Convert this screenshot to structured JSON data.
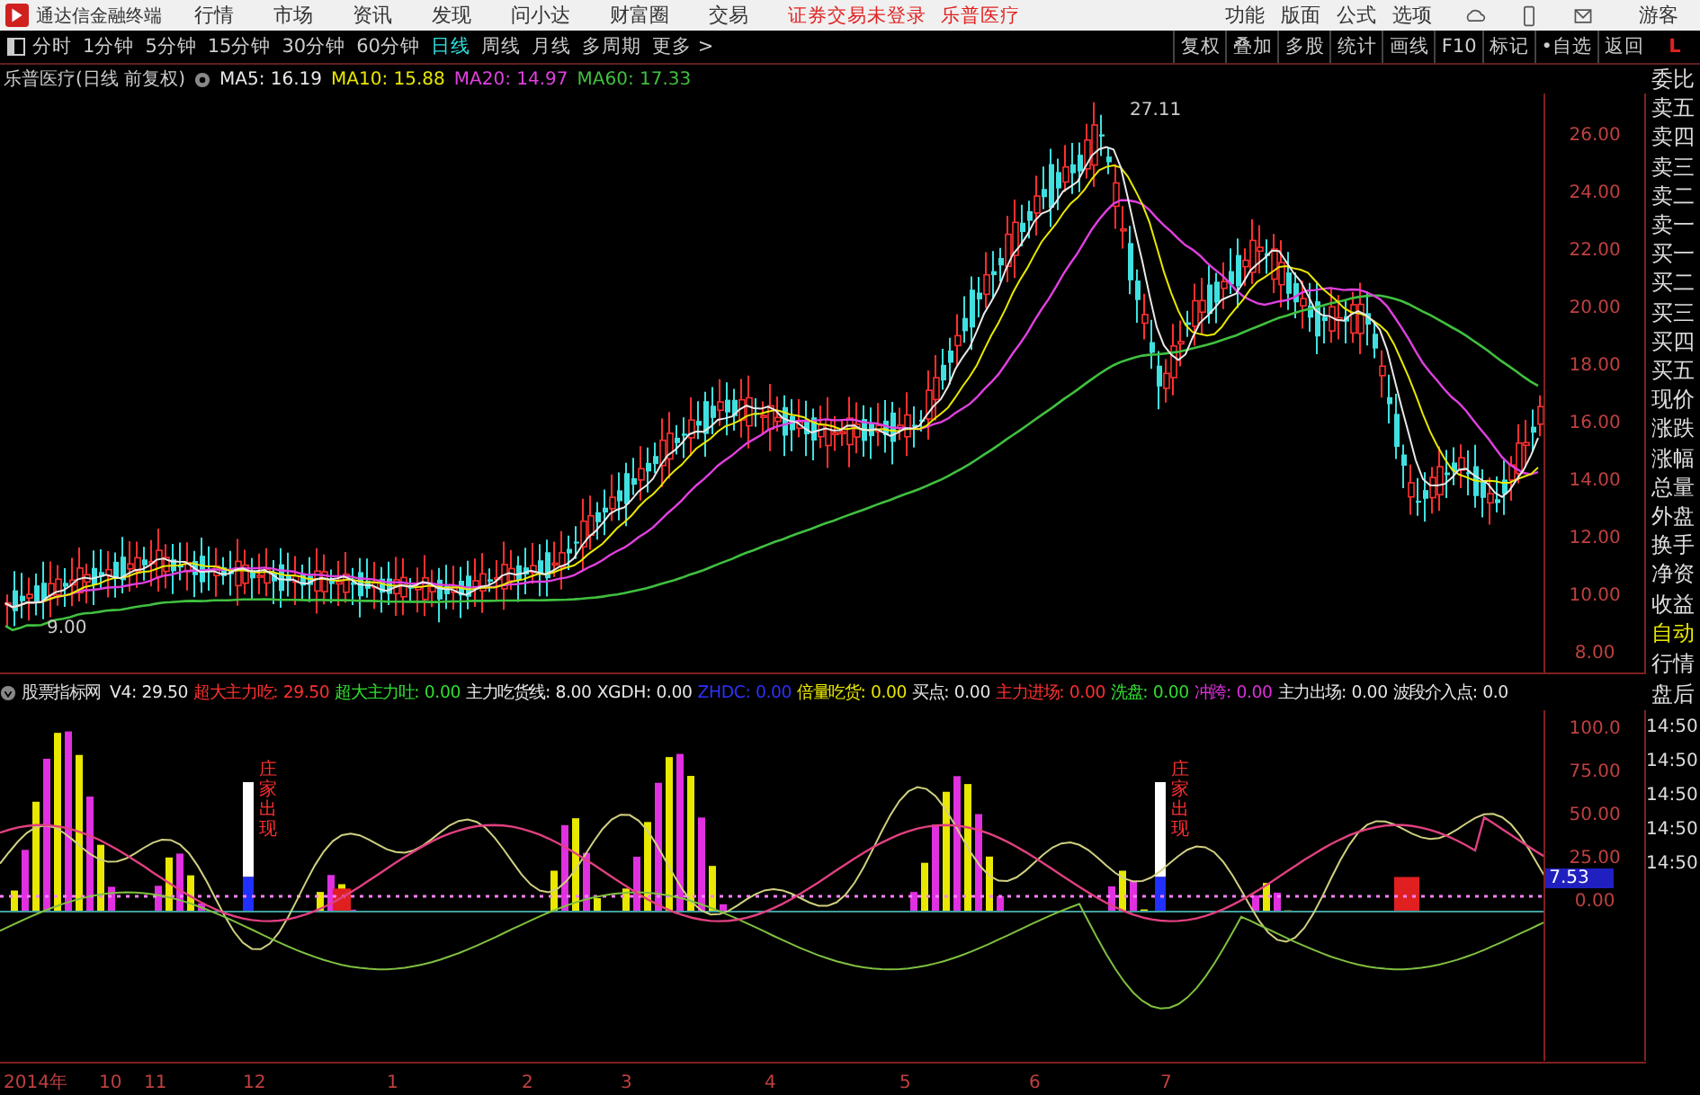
{
  "menu_bar": {
    "app_title": "通达信金融终端",
    "items": [
      "行情",
      "市场",
      "资讯",
      "发现",
      "问小达",
      "财富圈",
      "交易"
    ],
    "status": "证券交易未登录",
    "stock": "乐普医疗",
    "right_items": [
      "功能",
      "版面",
      "公式",
      "选项"
    ],
    "user": "游客"
  },
  "toolbar": {
    "periods": [
      {
        "label": "分时",
        "selected": false
      },
      {
        "label": "1分钟",
        "selected": false
      },
      {
        "label": "5分钟",
        "selected": false
      },
      {
        "label": "15分钟",
        "selected": false
      },
      {
        "label": "30分钟",
        "selected": false
      },
      {
        "label": "60分钟",
        "selected": false
      },
      {
        "label": "日线",
        "selected": true
      },
      {
        "label": "周线",
        "selected": false
      },
      {
        "label": "月线",
        "selected": false
      },
      {
        "label": "多周期",
        "selected": false
      },
      {
        "label": "更多 >",
        "selected": false
      }
    ],
    "buttons": [
      "复权",
      "叠加",
      "多股",
      "统计",
      "画线",
      "F10",
      "标记",
      "•自选",
      "返回"
    ],
    "corner": "L"
  },
  "chart": {
    "title": "乐普医疗(日线 前复权)",
    "ma": [
      {
        "label": "MA5: 16.19",
        "color": "#e8e8e8"
      },
      {
        "label": "MA10: 15.88",
        "color": "#e8e800"
      },
      {
        "label": "MA20: 14.97",
        "color": "#e040e0"
      },
      {
        "label": "MA60: 17.33",
        "color": "#40c040"
      }
    ],
    "price_ticks": [
      "26.00",
      "24.00",
      "22.00",
      "20.00",
      "18.00",
      "16.00",
      "14.00",
      "12.00",
      "10.00",
      "8.00"
    ],
    "high_label": "27.11",
    "low_label": "9.00"
  },
  "side_panel": {
    "quote_items": [
      "委比",
      "卖五",
      "卖四",
      "卖三",
      "卖二",
      "卖一",
      "买一",
      "买二",
      "买三",
      "买四",
      "买五",
      "现价",
      "涨跌",
      "涨幅",
      "总量",
      "外盘",
      "换手",
      "净资",
      "收益"
    ],
    "tabs": [
      "自动",
      "行情",
      "盘后"
    ],
    "ticks": [
      "14:50",
      "14:50",
      "14:50",
      "14:50",
      "14:50"
    ]
  },
  "indicator": {
    "name": "股票指标网",
    "legend": [
      {
        "label": "V4:",
        "value": "29.50",
        "color": "#e8e8e8"
      },
      {
        "label": "超大主力吃:",
        "value": "29.50",
        "color": "#ff3030"
      },
      {
        "label": "超大主力吐:",
        "value": "0.00",
        "color": "#30e030"
      },
      {
        "label": "主力吃货线:",
        "value": "8.00",
        "color": "#e8e8e8"
      },
      {
        "label": "XGDH:",
        "value": "0.00",
        "color": "#e8e8e8"
      },
      {
        "label": "ZHDC:",
        "value": "0.00",
        "color": "#3030ff"
      },
      {
        "label": "倍量吃货:",
        "value": "0.00",
        "color": "#e8e800"
      },
      {
        "label": "买点:",
        "value": "0.00",
        "color": "#e8e8e8"
      },
      {
        "label": "主力进场:",
        "value": "0.00",
        "color": "#ff3030"
      },
      {
        "label": "洗盘:",
        "value": "0.00",
        "color": "#30e030"
      },
      {
        "label": "冲跨:",
        "value": "0.00",
        "color": "#e030e0"
      },
      {
        "label": "主力出场:",
        "value": "0.00",
        "color": "#e8e8e8"
      },
      {
        "label": "波段介入点:",
        "value": "0.0",
        "color": "#e8e8e8"
      }
    ],
    "ticks": [
      "100.0",
      "75.00",
      "50.00",
      "25.00",
      "0.00"
    ],
    "current": "7.53",
    "signals": [
      "庄家出现",
      "庄家出现"
    ]
  },
  "date_axis": [
    "2014年",
    "10",
    "11",
    "12",
    "1",
    "2",
    "3",
    "4",
    "5",
    "6",
    "7"
  ]
}
